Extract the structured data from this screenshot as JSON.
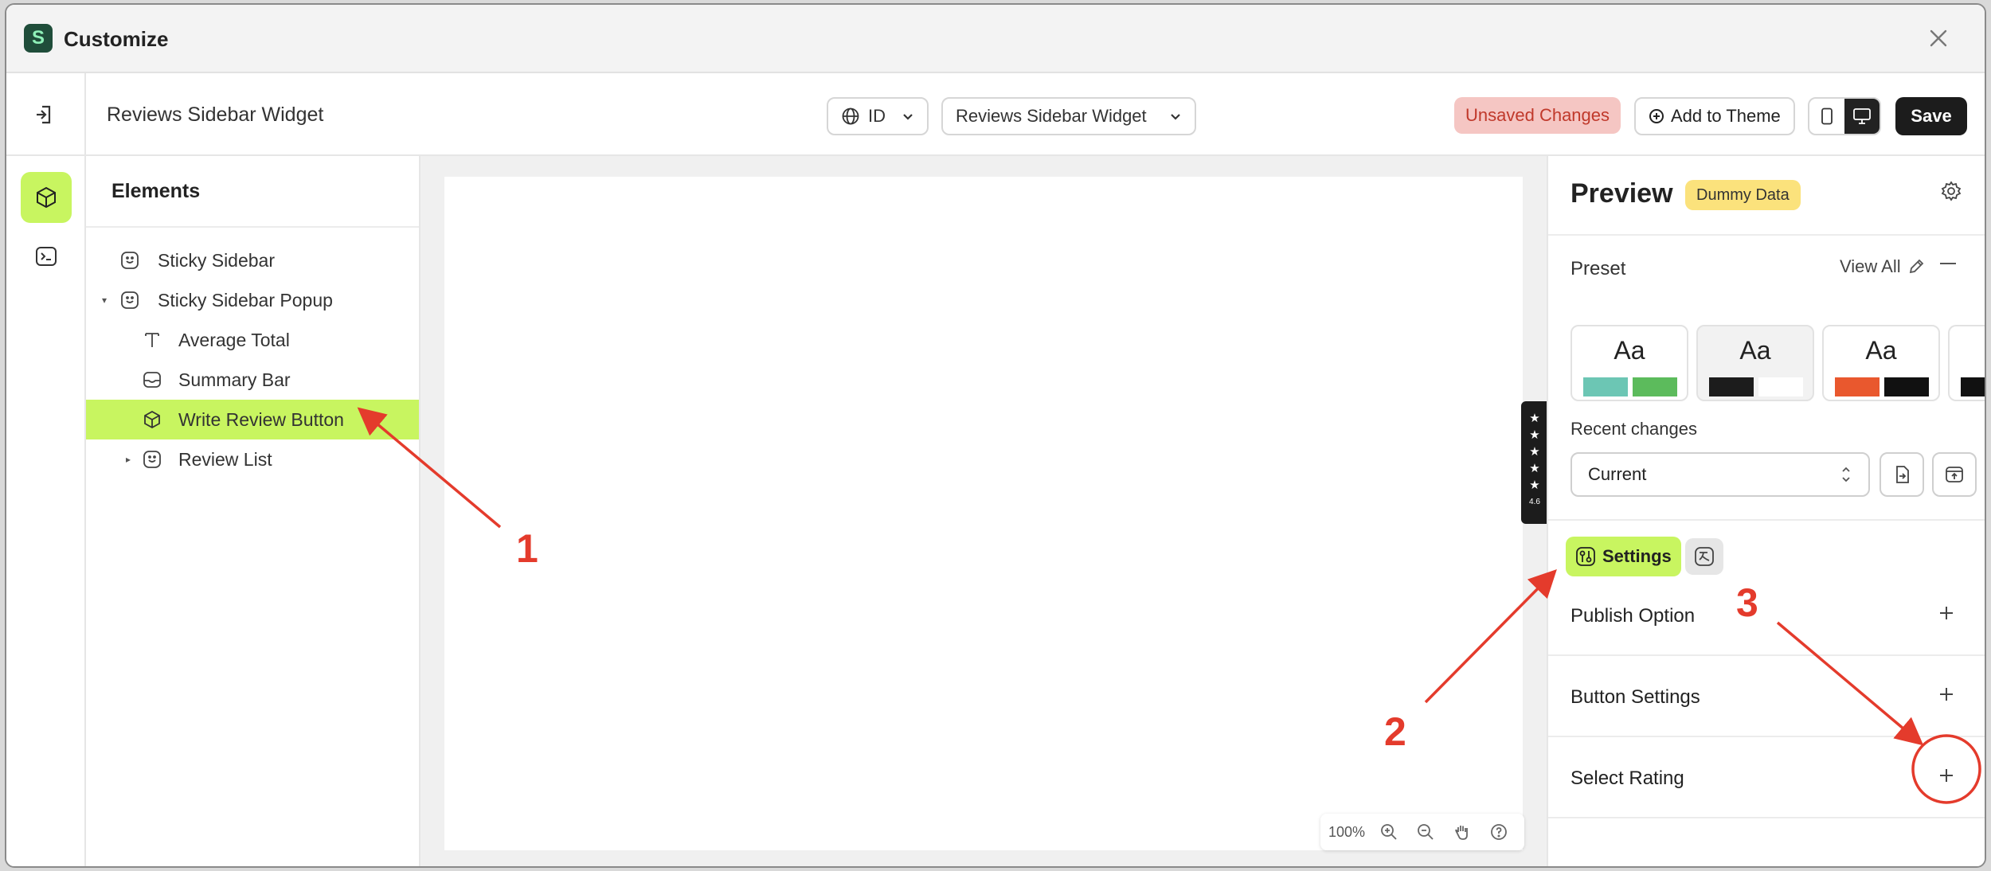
{
  "window": {
    "title": "Customize",
    "logo_letter": "S"
  },
  "toolbar": {
    "page_name": "Reviews Sidebar Widget",
    "language": "ID",
    "widget_select": "Reviews Sidebar Widget",
    "unsaved": "Unsaved Changes",
    "add_to_theme": "Add to Theme",
    "save": "Save"
  },
  "elements": {
    "header": "Elements",
    "items": [
      {
        "label": "Sticky Sidebar",
        "icon": "sticker-icon",
        "depth": 0,
        "caret": ""
      },
      {
        "label": "Sticky Sidebar Popup",
        "icon": "sticker-icon",
        "depth": 0,
        "caret": "▾"
      },
      {
        "label": "Average Total",
        "icon": "text-icon",
        "depth": 1,
        "caret": ""
      },
      {
        "label": "Summary Bar",
        "icon": "inbox-icon",
        "depth": 1,
        "caret": ""
      },
      {
        "label": "Write Review Button",
        "icon": "cube-icon",
        "depth": 1,
        "caret": "",
        "selected": true
      },
      {
        "label": "Review List",
        "icon": "sticker-icon",
        "depth": 1,
        "caret": "▸"
      }
    ]
  },
  "canvas": {
    "rating_stars": [
      "★",
      "★",
      "★",
      "★",
      "★"
    ],
    "rating_score": "4.6",
    "zoom": "100%"
  },
  "preview": {
    "title": "Preview",
    "badge": "Dummy Data",
    "preset_label": "Preset",
    "view_all": "View All",
    "presets": [
      {
        "label": "Aa",
        "colors": [
          "#6cc6b4",
          "#5cbb5c"
        ]
      },
      {
        "label": "Aa",
        "colors": [
          "#1c1c1c",
          "#ffffff"
        ]
      },
      {
        "label": "Aa",
        "colors": [
          "#e9582e",
          "#111111"
        ]
      },
      {
        "label": "",
        "colors": [
          "#111111",
          "#ffffff"
        ]
      }
    ],
    "recent_label": "Recent changes",
    "recent_value": "Current",
    "settings_tab": "Settings",
    "sections": [
      "Publish Option",
      "Button Settings",
      "Select Rating"
    ]
  },
  "annotations": [
    "1",
    "2",
    "3"
  ],
  "colors": {
    "accent": "#c8f560",
    "annotation": "#e43b2c",
    "unsaved_bg": "#f5c6c3",
    "unsaved_text": "#c0392b",
    "badge": "#fbe27c"
  }
}
